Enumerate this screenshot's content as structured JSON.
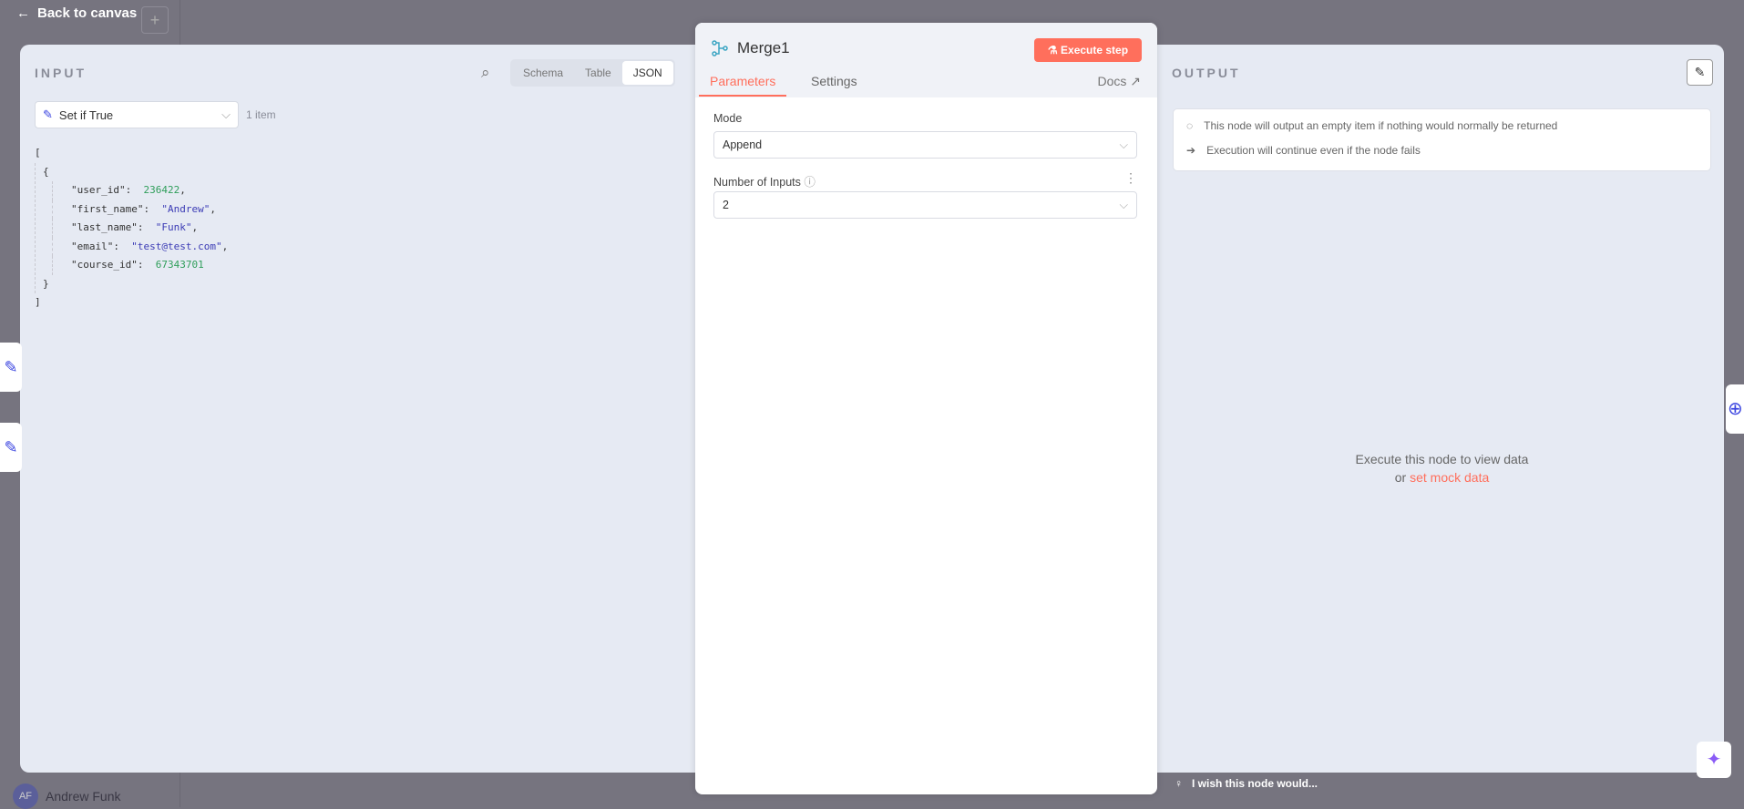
{
  "topbar": {
    "back_label": "Back to canvas",
    "plus": "+"
  },
  "user": {
    "initials": "AF",
    "name": "Andrew Funk"
  },
  "input": {
    "label": "INPUT",
    "views": [
      "Schema",
      "Table",
      "JSON"
    ],
    "active_view": "JSON",
    "node": "Set if True",
    "item_count": "1 item",
    "json": [
      {
        "key": "\"user_id\":",
        "value": "236422",
        "type": "num",
        "comma": ","
      },
      {
        "key": "\"first_name\":",
        "value": "\"Andrew\"",
        "type": "str",
        "comma": ","
      },
      {
        "key": "\"last_name\":",
        "value": "\"Funk\"",
        "type": "str",
        "comma": ","
      },
      {
        "key": "\"email\":",
        "value": "\"test@test.com\"",
        "type": "str",
        "comma": ","
      },
      {
        "key": "\"course_id\":",
        "value": "67343701",
        "type": "num",
        "comma": ""
      }
    ]
  },
  "node": {
    "title": "Merge1",
    "execute_label": "Execute step",
    "tabs": [
      "Parameters",
      "Settings"
    ],
    "docs": "Docs",
    "mode_label": "Mode",
    "mode_value": "Append",
    "inputs_label": "Number of Inputs",
    "inputs_value": "2"
  },
  "output": {
    "label": "OUTPUT",
    "notices": [
      "This node will output an empty item if nothing would normally be returned",
      "Execution will continue even if the node fails"
    ],
    "empty_line1": "Execute this node to view data",
    "empty_or": "or",
    "mock_link": "set mock data"
  },
  "feedback": "I wish this node would..."
}
